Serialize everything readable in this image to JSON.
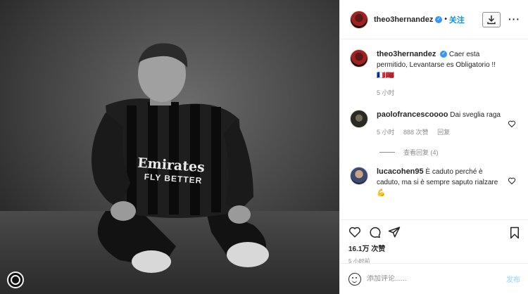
{
  "post": {
    "author": "theo3hernandez",
    "follow_label": "关注",
    "dot": "•",
    "more_label": "···",
    "caption_text": "Caer esta permitido, Levantarse es Obligatorio !! 🇫🇷🇲🇦",
    "caption_time": "5 小时"
  },
  "photo": {
    "jersey_sponsor": "Emirates",
    "jersey_sponsor_2": "FLY BETTER"
  },
  "comments": [
    {
      "user": "paolofrancescoooo",
      "text": "Dai sveglia raga",
      "time": "5 小时",
      "likes": "888 次赞",
      "reply_label": "回复",
      "view_replies": "查看回复 (4)"
    },
    {
      "user": "lucacohen95",
      "text": "È caduto perché è caduto, ma si è sempre saputo rialzare 💪"
    }
  ],
  "stats": {
    "views": "16.1万 次赞",
    "time": "5 小时前"
  },
  "composer": {
    "placeholder": "添加评论......",
    "post_label": "发布"
  },
  "icons": {
    "verified": "verified-badge-icon",
    "download": "download-icon",
    "heart": "heart-icon",
    "comment": "comment-icon",
    "share": "share-icon",
    "bookmark": "bookmark-icon",
    "emoji": "emoji-icon"
  }
}
